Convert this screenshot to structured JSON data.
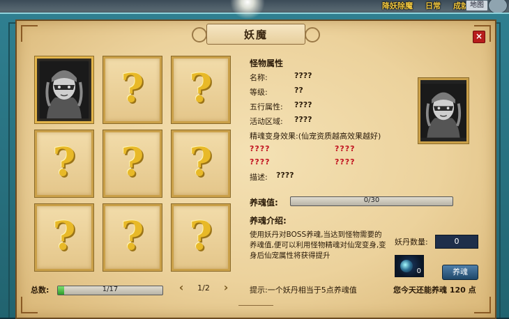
{
  "topbar": {
    "links": [
      "降妖除魔",
      "日常",
      "成就"
    ],
    "map_label": "地图"
  },
  "panel": {
    "title": "妖魔",
    "close_label": "×"
  },
  "grid": {
    "selected_index": 0,
    "unknown_mark": "?",
    "cards": [
      {
        "state": "revealed"
      },
      {
        "state": "unknown"
      },
      {
        "state": "unknown"
      },
      {
        "state": "unknown"
      },
      {
        "state": "unknown"
      },
      {
        "state": "unknown"
      },
      {
        "state": "unknown"
      },
      {
        "state": "unknown"
      },
      {
        "state": "unknown"
      }
    ]
  },
  "info": {
    "heading": "怪物属性",
    "rows": [
      {
        "label": "名称:",
        "value": "????"
      },
      {
        "label": "等级:",
        "value": "??"
      },
      {
        "label": "五行属性:",
        "value": "????"
      },
      {
        "label": "活动区域:",
        "value": "????"
      }
    ],
    "transform_label": "精魂变身效果:(仙宠资质越高效果越好)",
    "transform_values": [
      "????",
      "????",
      "????",
      "????"
    ],
    "desc_label": "描述:",
    "desc_value": "????"
  },
  "sacrifice": {
    "label": "养魂值:",
    "current": 0,
    "max": 30,
    "text": "0/30"
  },
  "intro": {
    "heading": "养魂介绍:",
    "text": "使用妖丹对BOSS养魂,当达到怪物需要的养魂值,便可以利用怪物精魂对仙宠变身,变身后仙宠属性将获得提升"
  },
  "yaodan": {
    "label": "妖丹数量:",
    "value": "0",
    "item_count": "0",
    "button_label": "养魂"
  },
  "footer": {
    "tip": "提示:一个妖丹相当于5点养魂值",
    "remain": "您今天还能养魂 120 点",
    "total_label": "总数:",
    "total_current": 1,
    "total_max": 17,
    "total_text": "1/17",
    "page_text": "1/2",
    "prev_label": "‹",
    "next_label": "›"
  },
  "colors": {
    "accent_gold": "#e8b928",
    "red_unknown": "#c1121f",
    "progress_green": "#2f9b2a"
  }
}
